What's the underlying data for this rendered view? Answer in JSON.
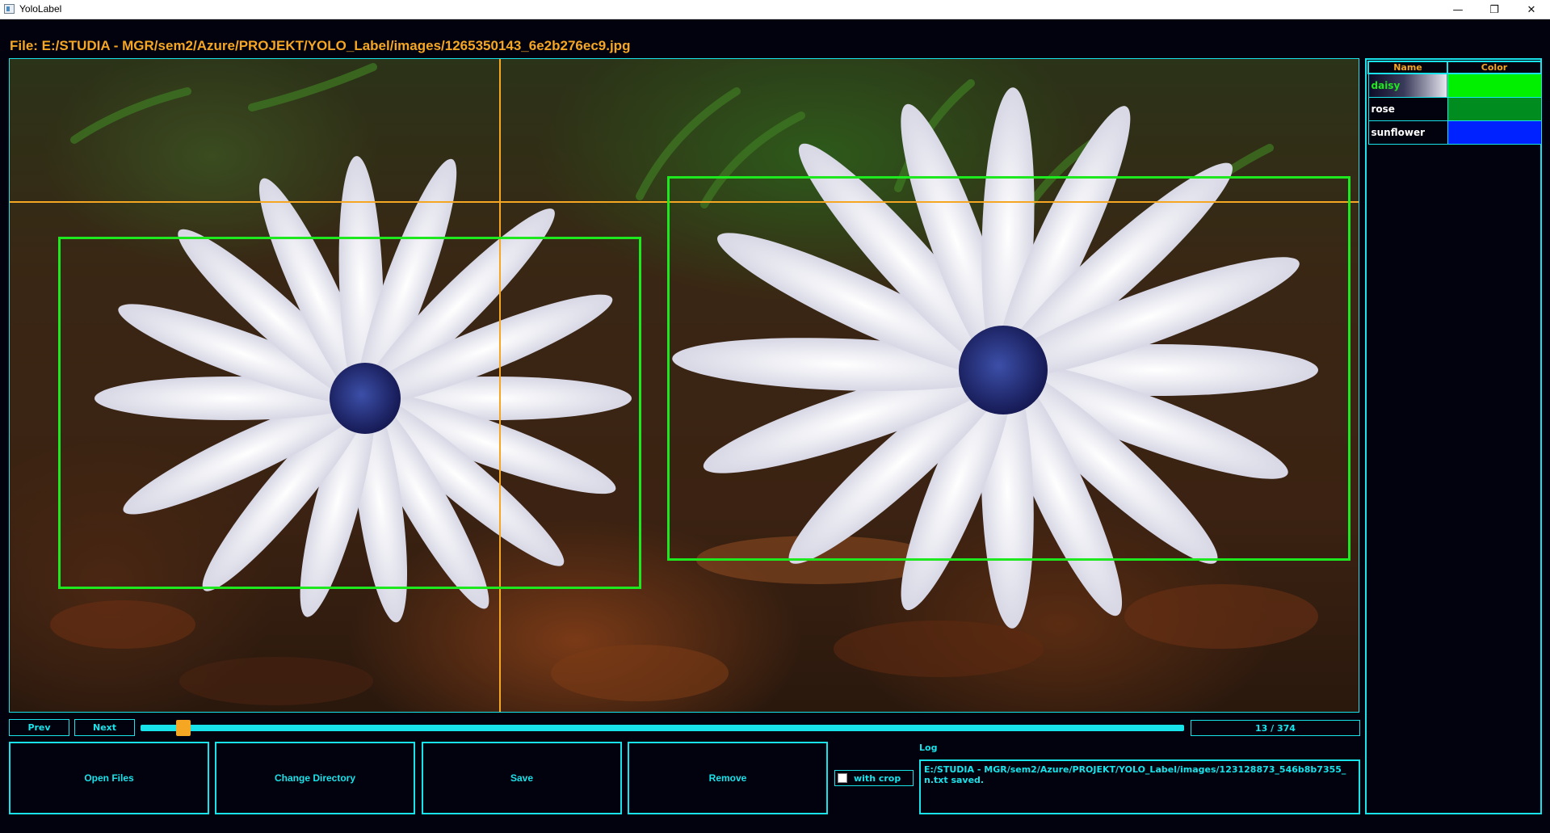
{
  "window": {
    "title": "YoloLabel",
    "minimize": "—",
    "maximize": "❐",
    "close": "✕"
  },
  "file_label": "File: E:/STUDIA - MGR/sem2/Azure/PROJEKT/YOLO_Label/images/1265350143_6e2b276ec9.jpg",
  "nav": {
    "prev": "Prev",
    "next": "Next",
    "counter": "13 / 374",
    "progress": 0.0348
  },
  "actions": {
    "open_files": "Open Files",
    "change_directory": "Change Directory",
    "save": "Save",
    "remove": "Remove",
    "with_crop": "with crop"
  },
  "log": {
    "label": "Log",
    "text": "E:/STUDIA - MGR/sem2/Azure/PROJEKT/YOLO_Label/images/123128873_546b8b7355_n.txt saved."
  },
  "labels_panel": {
    "headers": {
      "name": "Name",
      "color": "Color"
    },
    "items": [
      {
        "name": "daisy",
        "color": "#00f000",
        "selected": true
      },
      {
        "name": "rose",
        "color": "#008c1e",
        "selected": false
      },
      {
        "name": "sunflower",
        "color": "#0022ff",
        "selected": false
      }
    ]
  },
  "colors": {
    "accent": "#19e3ea",
    "highlight": "#f5a623",
    "bbox": "#1ee81e",
    "background": "#02020f"
  }
}
